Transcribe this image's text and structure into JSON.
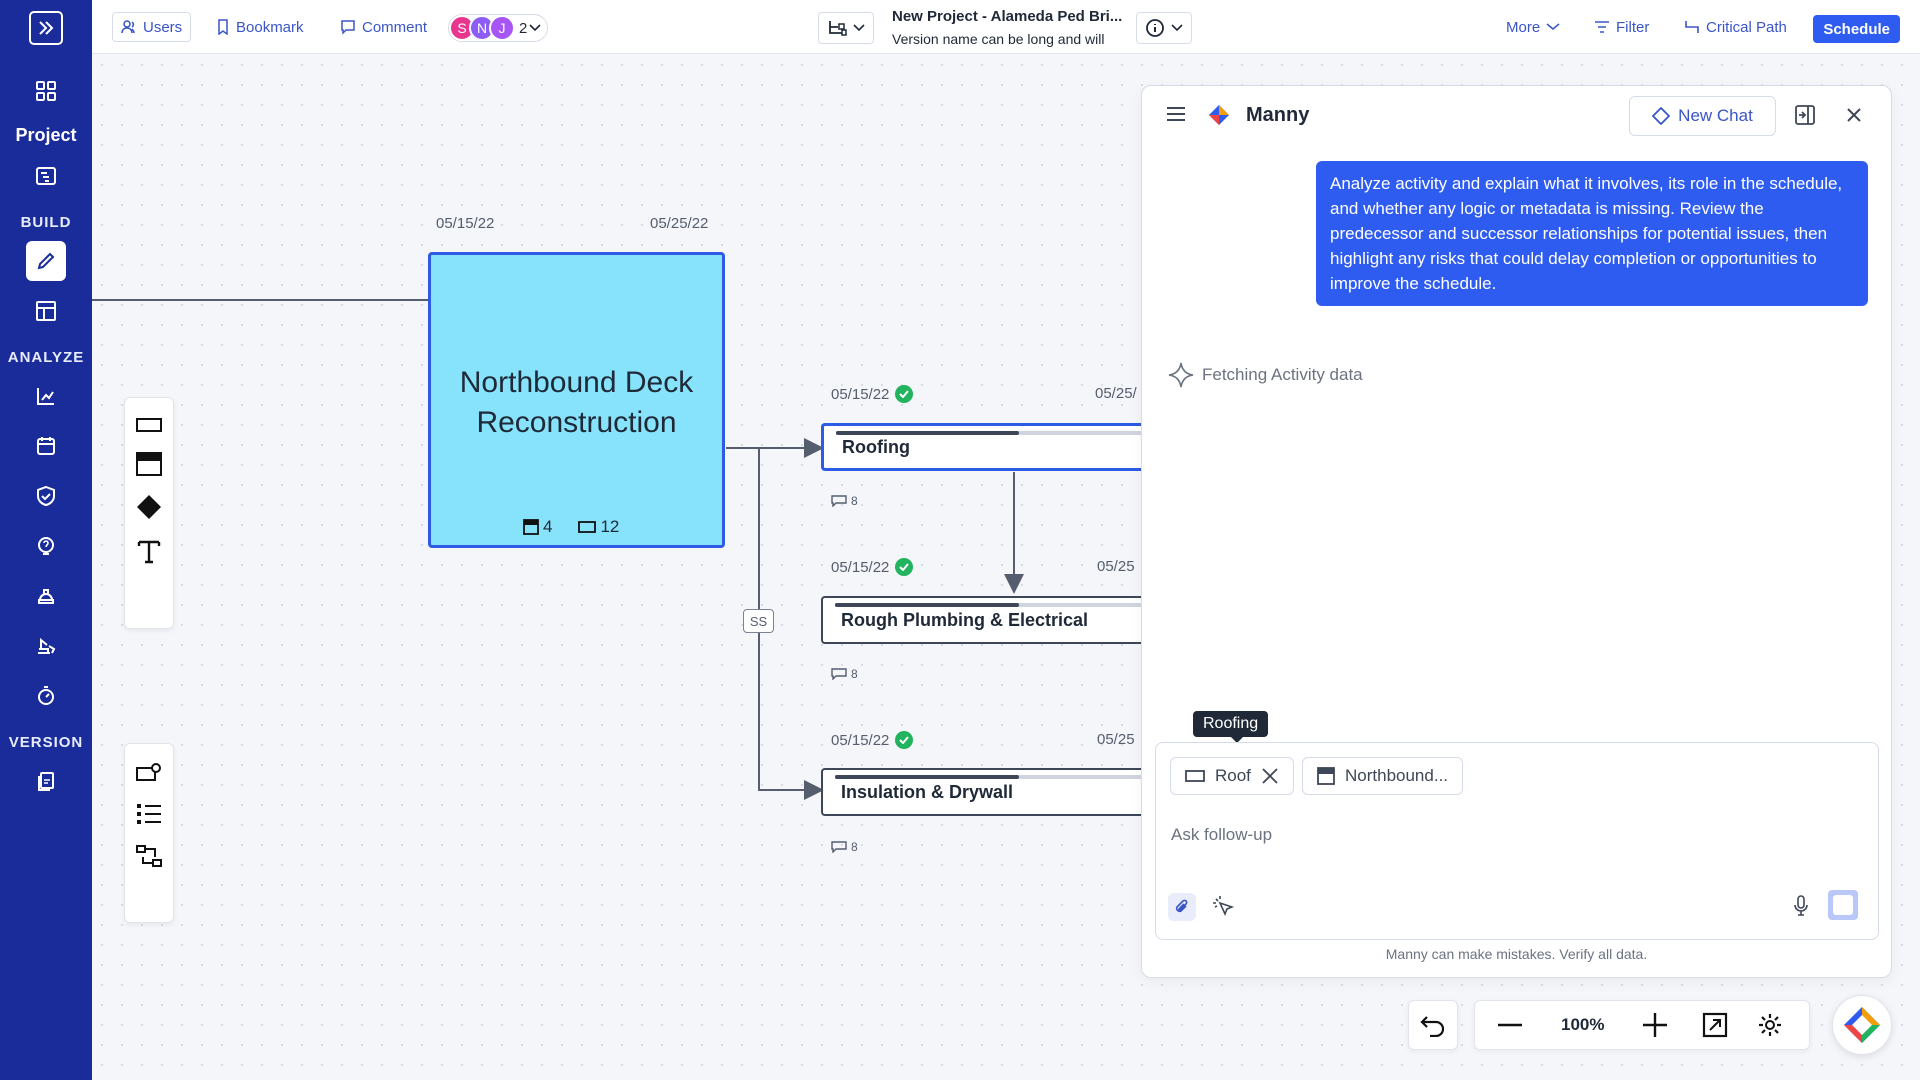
{
  "rail": {
    "project_label": "Project",
    "build_label": "BUILD",
    "analyze_label": "ANALYZE",
    "version_label": "VERSION"
  },
  "topbar": {
    "users": "Users",
    "bookmark": "Bookmark",
    "comment": "Comment",
    "avatars": [
      {
        "initial": "S",
        "color": "#e8368f"
      },
      {
        "initial": "N",
        "color": "#8b5cf6"
      },
      {
        "initial": "J",
        "color": "#a855f7"
      }
    ],
    "avatar_extra": "2",
    "project_title": "New Project - Alameda Ped Bri...",
    "version_note": "Version name can be long and will",
    "more": "More",
    "filter": "Filter",
    "critical_path": "Critical Path",
    "schedule": "Schedule"
  },
  "canvas": {
    "summary": {
      "start": "05/15/22",
      "end": "05/25/22",
      "title_line1": "Northbound Deck",
      "title_line2": "Reconstruction",
      "sub_count": "4",
      "act_count": "12",
      "color": "#86e3fb"
    },
    "activities": [
      {
        "name": "Roofing",
        "start": "05/15/22",
        "end": "05/25/",
        "count": "8",
        "progress": 0.6
      },
      {
        "name": "Rough Plumbing & Electrical",
        "start": "05/15/22",
        "end": "05/25",
        "count": "8",
        "progress": 0.6
      },
      {
        "name": "Insulation & Drywall",
        "start": "05/15/22",
        "end": "05/25",
        "count": "8",
        "progress": 0.6
      }
    ],
    "link_tag": "SS"
  },
  "chat": {
    "name": "Manny",
    "new_chat": "New Chat",
    "user_message": "Analyze activity and explain what it involves, its role in the schedule, and whether any logic or metadata is missing. Review the predecessor and successor relationships for potential issues, then highlight any risks that could delay completion or opportunities to improve the schedule.",
    "status": "Fetching Activity data",
    "tooltip": "Roofing",
    "chip1": "Roof",
    "chip2": "Northbound...",
    "placeholder": "Ask follow-up",
    "disclaimer": "Manny can make mistakes. Verify all data."
  },
  "controls": {
    "zoom": "100%"
  },
  "colors": {
    "rail": "#1a2b9a",
    "accent": "#2e5bf0",
    "selected_border": "#2d5be3",
    "done": "#22b35e"
  }
}
